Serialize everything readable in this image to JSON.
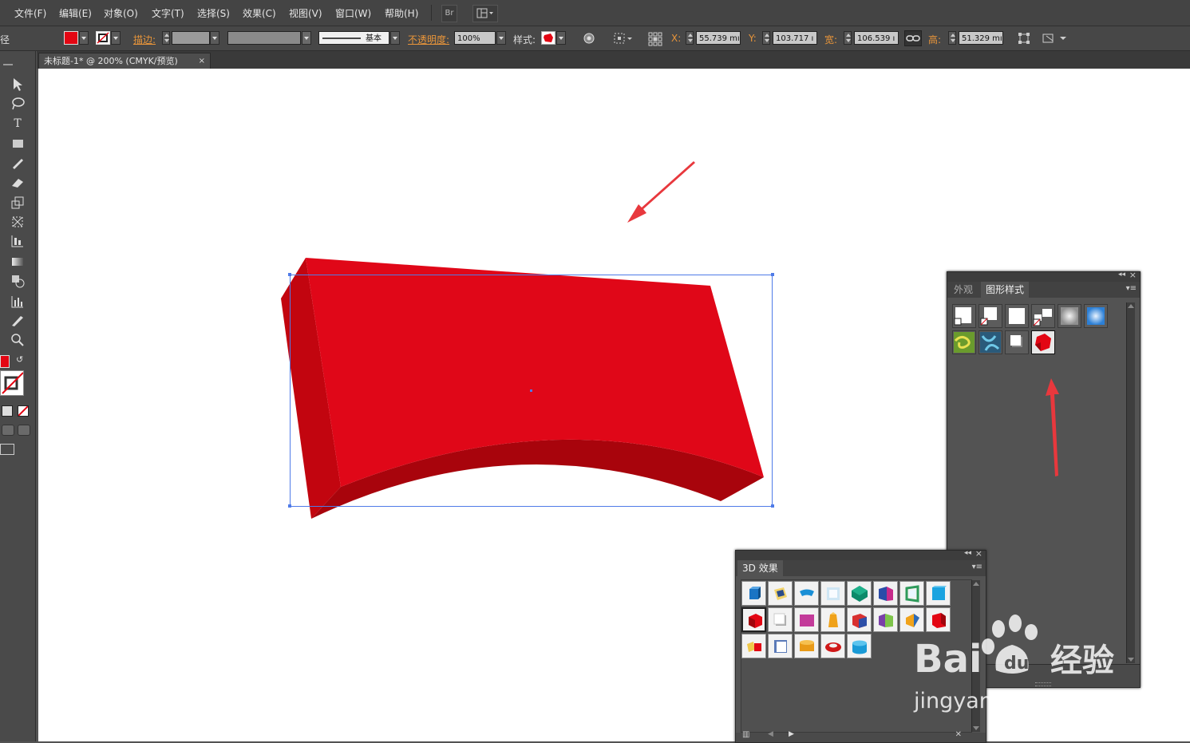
{
  "menubar": {
    "items": [
      "文件(F)",
      "编辑(E)",
      "对象(O)",
      "文字(T)",
      "选择(S)",
      "效果(C)",
      "视图(V)",
      "窗口(W)",
      "帮助(H)"
    ],
    "bridge_button": "Br"
  },
  "control_bar": {
    "left_cut_label": "径",
    "stroke_label": "描边:",
    "stroke_style_label": "基本",
    "opacity_label": "不透明度:",
    "opacity_value": "100%",
    "style_label": "样式:",
    "x_label": "X:",
    "x_value": "55.739 mı",
    "y_label": "Y:",
    "y_value": "103.717 ı",
    "width_label": "宽:",
    "width_value": "106.539 ı",
    "height_label": "高:",
    "height_value": "51.329 mı"
  },
  "document_tab": {
    "title": "未标题-1* @ 200% (CMYK/预览)",
    "close": "×"
  },
  "graphic_styles_panel": {
    "tab_appearance": "外观",
    "tab_graphic_styles": "图形样式",
    "collapse": "◂◂",
    "close": "×"
  },
  "effects_3d_panel": {
    "title": "3D 效果",
    "collapse": "◂◂",
    "close": "×"
  },
  "colors": {
    "fill": "#e30613",
    "shape_front": "#e00718",
    "shape_side": "#c2050f",
    "shape_bottom": "#a8040c",
    "selection": "#4f7be8",
    "arrow": "#e8383d"
  },
  "watermark": {
    "brand_left": "Bai",
    "brand_right": "经验",
    "url": "jingyan.baidu.com"
  }
}
